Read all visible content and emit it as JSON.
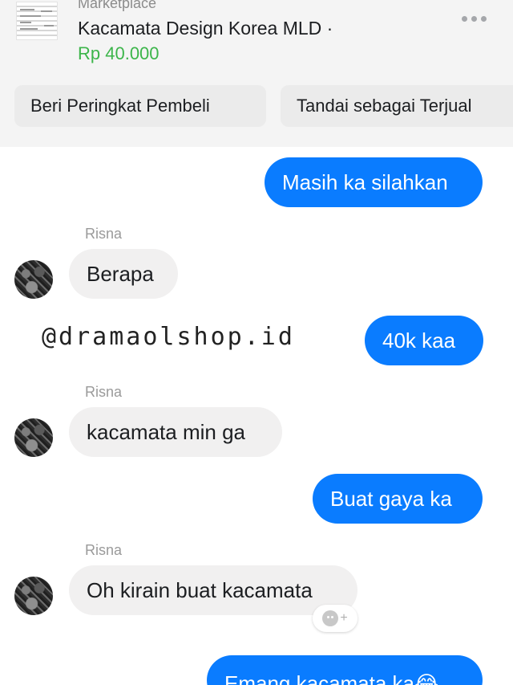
{
  "header": {
    "section_label": "Marketplace",
    "product_title": "Kacamata Design Korea MLD ·",
    "price": "Rp 40.000",
    "more_icon": "more-horizontal-icon",
    "actions": [
      {
        "label": "Beri Peringkat Pembeli"
      },
      {
        "label": "Tandai sebagai Terjual"
      }
    ]
  },
  "chat": {
    "messages": [
      {
        "direction": "outgoing",
        "text": "Masih ka silahkan"
      },
      {
        "direction": "incoming",
        "sender": "Risna",
        "text": "Berapa"
      },
      {
        "direction": "outgoing",
        "text": "40k kaa"
      },
      {
        "direction": "incoming",
        "sender": "Risna",
        "text": "kacamata min ga"
      },
      {
        "direction": "outgoing",
        "text": "Buat gaya ka"
      },
      {
        "direction": "incoming",
        "sender": "Risna",
        "text": "Oh kirain buat kacamata"
      },
      {
        "direction": "outgoing",
        "text": "Emang kacamata ka😂"
      }
    ],
    "reaction_icon": "add-reaction-icon"
  },
  "watermark": "@dramaolshop.id",
  "colors": {
    "outgoing_bubble": "#0a7cff",
    "incoming_bubble": "#f1f0f0",
    "price": "#3cb54a",
    "header_bg": "#f4f4f4"
  }
}
